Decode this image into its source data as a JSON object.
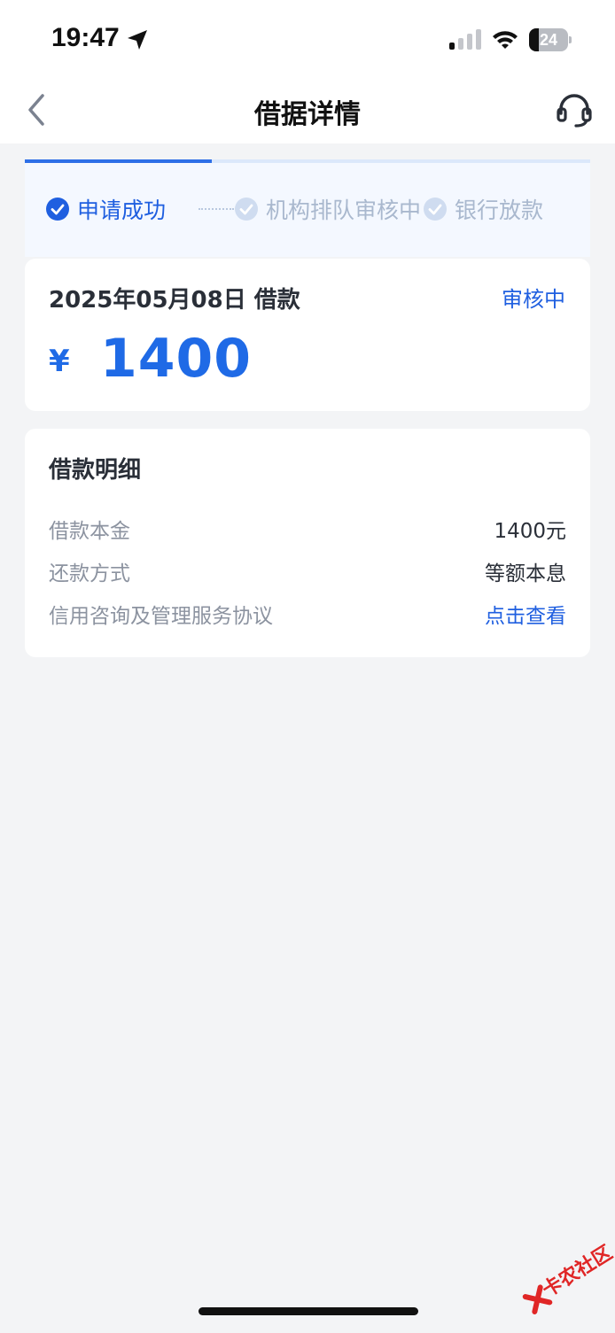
{
  "status_bar": {
    "time": "19:47",
    "battery_level": "24",
    "battery_fraction": 0.24,
    "signal_bars_active": 1,
    "signal_bars_total": 4
  },
  "nav": {
    "title": "借据详情",
    "back_icon": "chevron-left-icon",
    "service_icon": "headset-icon"
  },
  "progress": {
    "fraction_complete": 0.33,
    "steps": [
      {
        "label": "申请成功",
        "state": "done"
      },
      {
        "label": "机构排队审核中",
        "state": "pending"
      },
      {
        "label": "银行放款",
        "state": "pending"
      }
    ]
  },
  "loan": {
    "date_label": "2025年05月08日 借款",
    "status": "审核中",
    "currency": "¥",
    "amount": "1400"
  },
  "details": {
    "title": "借款明细",
    "rows": [
      {
        "label": "借款本金",
        "value": "1400元"
      },
      {
        "label": "还款方式",
        "value": "等额本息"
      },
      {
        "label": "信用咨询及管理服务协议",
        "value": "点击查看"
      }
    ]
  },
  "watermark": {
    "text": "卡农社区"
  },
  "colors": {
    "accent": "#1f5fe0",
    "amount": "#1f6ae6",
    "pending": "#a9b8ce",
    "background": "#f3f4f6"
  }
}
